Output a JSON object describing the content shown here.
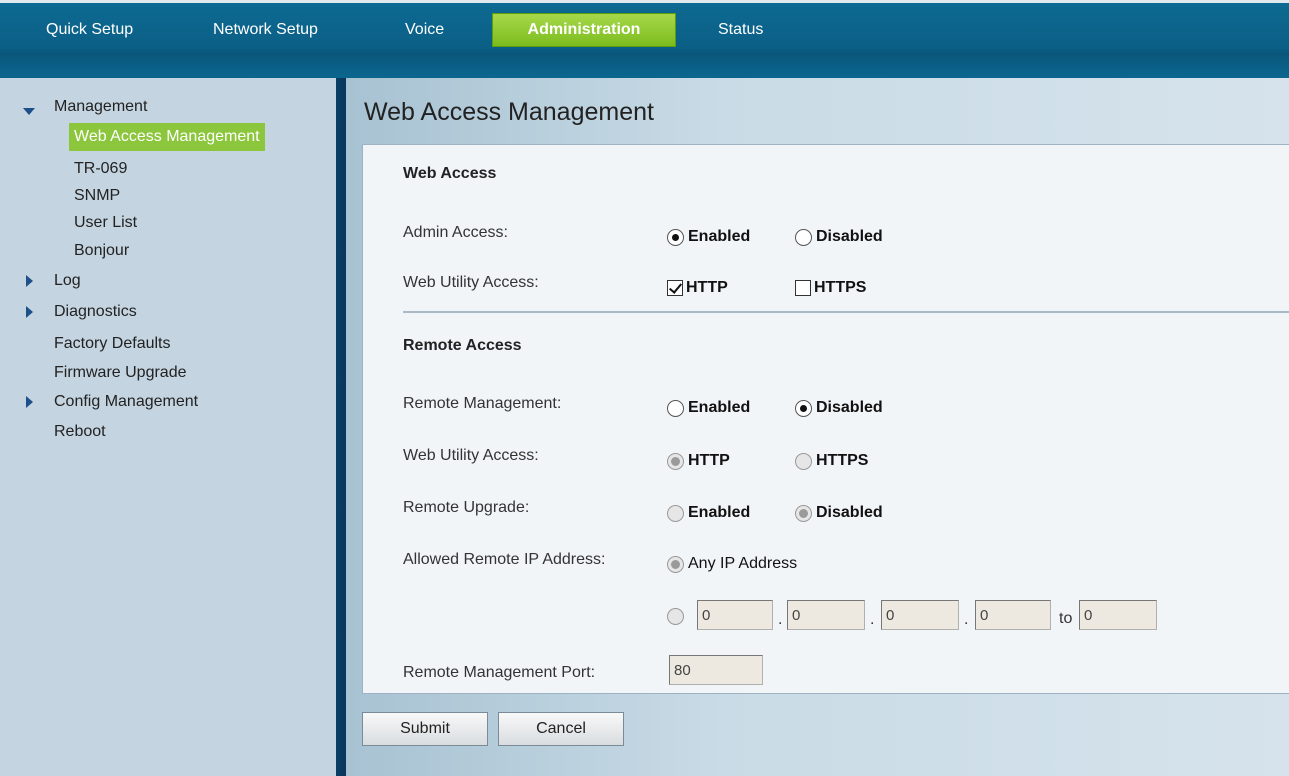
{
  "nav": {
    "items": [
      "Quick Setup",
      "Network Setup",
      "Voice",
      "Administration",
      "Status"
    ],
    "active": "Administration"
  },
  "sidebar": {
    "management": "Management",
    "sub": [
      "Web Access Management",
      "TR-069",
      "SNMP",
      "User List",
      "Bonjour"
    ],
    "log": "Log",
    "diagnostics": "Diagnostics",
    "factory_defaults": "Factory Defaults",
    "firmware_upgrade": "Firmware Upgrade",
    "config_management": "Config Management",
    "reboot": "Reboot"
  },
  "page": {
    "title": "Web Access Management"
  },
  "web_access": {
    "section": "Web Access",
    "admin_access_label": "Admin Access:",
    "admin_enabled": "Enabled",
    "admin_disabled": "Disabled",
    "admin_value": "Enabled",
    "web_utility_label": "Web Utility Access:",
    "http": "HTTP",
    "https": "HTTPS",
    "http_checked": true,
    "https_checked": false
  },
  "remote_access": {
    "section": "Remote Access",
    "remote_mgmt_label": "Remote Management:",
    "remote_mgmt_enabled": "Enabled",
    "remote_mgmt_disabled": "Disabled",
    "remote_mgmt_value": "Disabled",
    "web_utility_label": "Web Utility Access:",
    "http": "HTTP",
    "https": "HTTPS",
    "remote_upgrade_label": "Remote Upgrade:",
    "upgrade_enabled": "Enabled",
    "upgrade_disabled": "Disabled",
    "allowed_ip_label": "Allowed Remote IP Address:",
    "any_ip": "Any IP Address",
    "ip1": "0",
    "ip2": "0",
    "ip3": "0",
    "ip4": "0",
    "to_label": "to",
    "ip_to": "0",
    "port_label": "Remote Management Port:",
    "port_value": "80"
  },
  "buttons": {
    "submit": "Submit",
    "cancel": "Cancel"
  }
}
